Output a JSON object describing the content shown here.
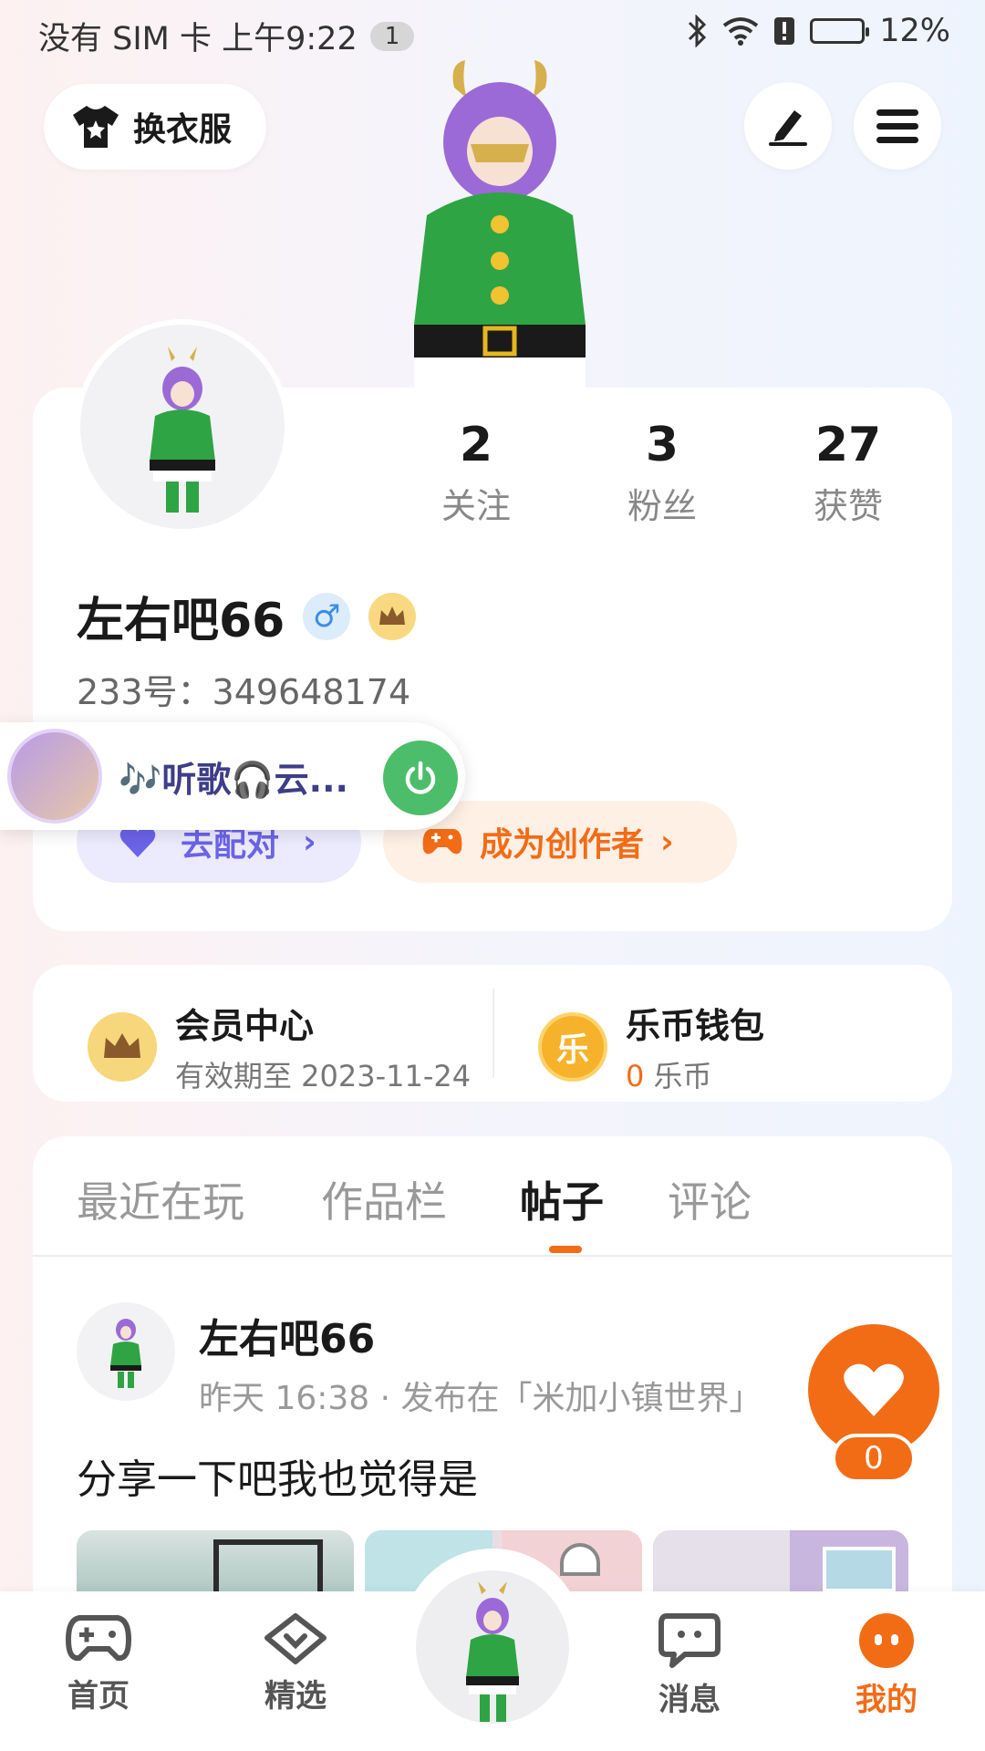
{
  "status_bar": {
    "left_text": "没有 SIM 卡 上午9:22",
    "notification_count": "1",
    "battery": "12%"
  },
  "header": {
    "outfit_label": "换衣服",
    "edit_icon": "pen-icon",
    "menu_icon": "hamburger-menu-icon"
  },
  "profile": {
    "username": "左右吧66",
    "gender_symbol": "♂",
    "uid_label": "233号：",
    "uid_value": "349648174",
    "stats": [
      {
        "value": "2",
        "label": "关注"
      },
      {
        "value": "3",
        "label": "粉丝"
      },
      {
        "value": "27",
        "label": "获赞"
      }
    ],
    "pair_button": "去配对",
    "creator_button": "成为创作者"
  },
  "music_pill": {
    "text": "🎶听歌🎧云..."
  },
  "wallet": {
    "vip_title": "会员中心",
    "vip_sub": "有效期至 2023-11-24",
    "coin_title": "乐币钱包",
    "coin_amount": "0",
    "coin_unit": " 乐币",
    "coin_char": "乐"
  },
  "tabs": [
    {
      "label": "最近在玩",
      "active": false
    },
    {
      "label": "作品栏",
      "active": false
    },
    {
      "label": "帖子",
      "active": true
    },
    {
      "label": "评论",
      "active": false
    }
  ],
  "post": {
    "author": "左右吧66",
    "meta": "昨天 16:38 · 发布在「米加小镇世界」",
    "text": "分享一下吧我也觉得是",
    "like_count": "0"
  },
  "bottom_nav": [
    {
      "label": "首页",
      "icon": "gamepad-icon",
      "active": false
    },
    {
      "label": "精选",
      "icon": "heart-chat-icon",
      "active": false
    },
    {
      "label": "消息",
      "icon": "message-icon",
      "active": false
    },
    {
      "label": "我的",
      "icon": "profile-face-icon",
      "active": true
    }
  ],
  "colors": {
    "accent": "#f26c16",
    "pair": "#6b63e8",
    "power": "#4cbd6a"
  }
}
